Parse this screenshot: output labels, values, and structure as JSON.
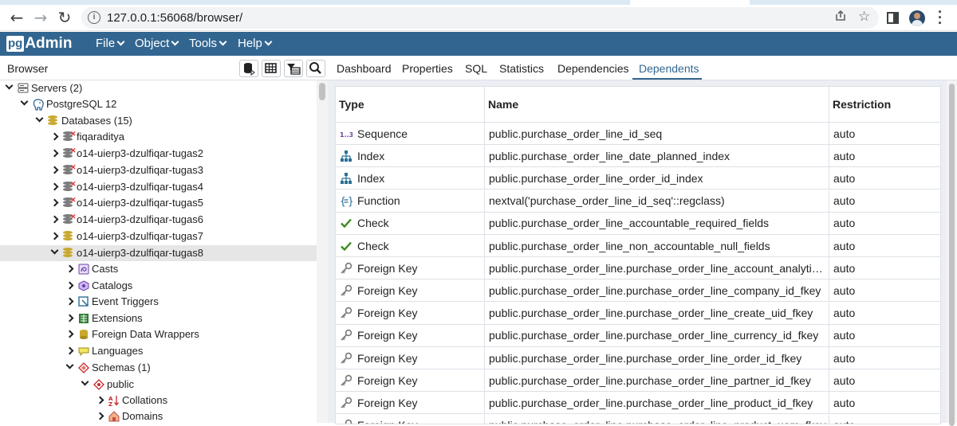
{
  "browser": {
    "url": "127.0.0.1:56068/browser/"
  },
  "app": {
    "logo_pg": "pg",
    "logo_admin": "Admin",
    "menu": [
      "File",
      "Object",
      "Tools",
      "Help"
    ]
  },
  "browser_panel": {
    "title": "Browser"
  },
  "tree": [
    {
      "label": "Servers (2)",
      "level": 0,
      "expanded": true,
      "icon": "servers-icon"
    },
    {
      "label": "PostgreSQL 12",
      "level": 1,
      "expanded": true,
      "icon": "postgres-elephant-icon"
    },
    {
      "label": "Databases (15)",
      "level": 2,
      "expanded": true,
      "icon": "databases-icon"
    },
    {
      "label": "fiqaraditya",
      "level": 3,
      "expanded": false,
      "icon": "database-disconnected-icon"
    },
    {
      "label": "o14-uierp3-dzulfiqar-tugas2",
      "level": 3,
      "expanded": false,
      "icon": "database-disconnected-icon"
    },
    {
      "label": "o14-uierp3-dzulfiqar-tugas3",
      "level": 3,
      "expanded": false,
      "icon": "database-disconnected-icon"
    },
    {
      "label": "o14-uierp3-dzulfiqar-tugas4",
      "level": 3,
      "expanded": false,
      "icon": "database-disconnected-icon"
    },
    {
      "label": "o14-uierp3-dzulfiqar-tugas5",
      "level": 3,
      "expanded": false,
      "icon": "database-disconnected-icon"
    },
    {
      "label": "o14-uierp3-dzulfiqar-tugas6",
      "level": 3,
      "expanded": false,
      "icon": "database-disconnected-icon"
    },
    {
      "label": "o14-uierp3-dzulfiqar-tugas7",
      "level": 3,
      "expanded": false,
      "icon": "database-connected-icon"
    },
    {
      "label": "o14-uierp3-dzulfiqar-tugas8",
      "level": 3,
      "expanded": true,
      "icon": "database-connected-icon",
      "selected": true
    },
    {
      "label": "Casts",
      "level": 4,
      "expanded": false,
      "icon": "casts-icon"
    },
    {
      "label": "Catalogs",
      "level": 4,
      "expanded": false,
      "icon": "catalogs-icon"
    },
    {
      "label": "Event Triggers",
      "level": 4,
      "expanded": false,
      "icon": "event-triggers-icon"
    },
    {
      "label": "Extensions",
      "level": 4,
      "expanded": false,
      "icon": "extensions-icon"
    },
    {
      "label": "Foreign Data Wrappers",
      "level": 4,
      "expanded": false,
      "icon": "foreign-data-wrappers-icon"
    },
    {
      "label": "Languages",
      "level": 4,
      "expanded": false,
      "icon": "languages-icon"
    },
    {
      "label": "Schemas (1)",
      "level": 4,
      "expanded": true,
      "icon": "schemas-icon"
    },
    {
      "label": "public",
      "level": 5,
      "expanded": true,
      "icon": "schema-icon"
    },
    {
      "label": "Collations",
      "level": 6,
      "expanded": false,
      "icon": "collations-icon"
    },
    {
      "label": "Domains",
      "level": 6,
      "expanded": false,
      "icon": "domains-icon"
    }
  ],
  "tabs": [
    "Dashboard",
    "Properties",
    "SQL",
    "Statistics",
    "Dependencies",
    "Dependents"
  ],
  "active_tab": "Dependents",
  "dependents": {
    "columns": [
      "Type",
      "Name",
      "Restriction"
    ],
    "rows": [
      {
        "type": "Sequence",
        "icon": "sequence-icon",
        "name": "public.purchase_order_line_id_seq",
        "restriction": "auto"
      },
      {
        "type": "Index",
        "icon": "index-icon",
        "name": "public.purchase_order_line_date_planned_index",
        "restriction": "auto"
      },
      {
        "type": "Index",
        "icon": "index-icon",
        "name": "public.purchase_order_line_order_id_index",
        "restriction": "auto"
      },
      {
        "type": "Function",
        "icon": "function-icon",
        "name": "nextval('purchase_order_line_id_seq'::regclass)",
        "restriction": "auto"
      },
      {
        "type": "Check",
        "icon": "check-icon",
        "name": "public.purchase_order_line_accountable_required_fields",
        "restriction": "auto"
      },
      {
        "type": "Check",
        "icon": "check-icon",
        "name": "public.purchase_order_line_non_accountable_null_fields",
        "restriction": "auto"
      },
      {
        "type": "Foreign Key",
        "icon": "foreign-key-icon",
        "name": "public.purchase_order_line.purchase_order_line_account_analytic_id_fkey",
        "restriction": "auto"
      },
      {
        "type": "Foreign Key",
        "icon": "foreign-key-icon",
        "name": "public.purchase_order_line.purchase_order_line_company_id_fkey",
        "restriction": "auto"
      },
      {
        "type": "Foreign Key",
        "icon": "foreign-key-icon",
        "name": "public.purchase_order_line.purchase_order_line_create_uid_fkey",
        "restriction": "auto"
      },
      {
        "type": "Foreign Key",
        "icon": "foreign-key-icon",
        "name": "public.purchase_order_line.purchase_order_line_currency_id_fkey",
        "restriction": "auto"
      },
      {
        "type": "Foreign Key",
        "icon": "foreign-key-icon",
        "name": "public.purchase_order_line.purchase_order_line_order_id_fkey",
        "restriction": "auto"
      },
      {
        "type": "Foreign Key",
        "icon": "foreign-key-icon",
        "name": "public.purchase_order_line.purchase_order_line_partner_id_fkey",
        "restriction": "auto"
      },
      {
        "type": "Foreign Key",
        "icon": "foreign-key-icon",
        "name": "public.purchase_order_line.purchase_order_line_product_id_fkey",
        "restriction": "auto"
      },
      {
        "type": "Foreign Key",
        "icon": "foreign-key-icon",
        "name": "public.purchase_order_line.purchase_order_line_product_uom_fkey",
        "restriction": "auto"
      }
    ]
  },
  "colors": {
    "header": "#326690",
    "accent": "#326690",
    "selected_row": "#e6e6e6",
    "content_bg": "#ebeef3"
  }
}
